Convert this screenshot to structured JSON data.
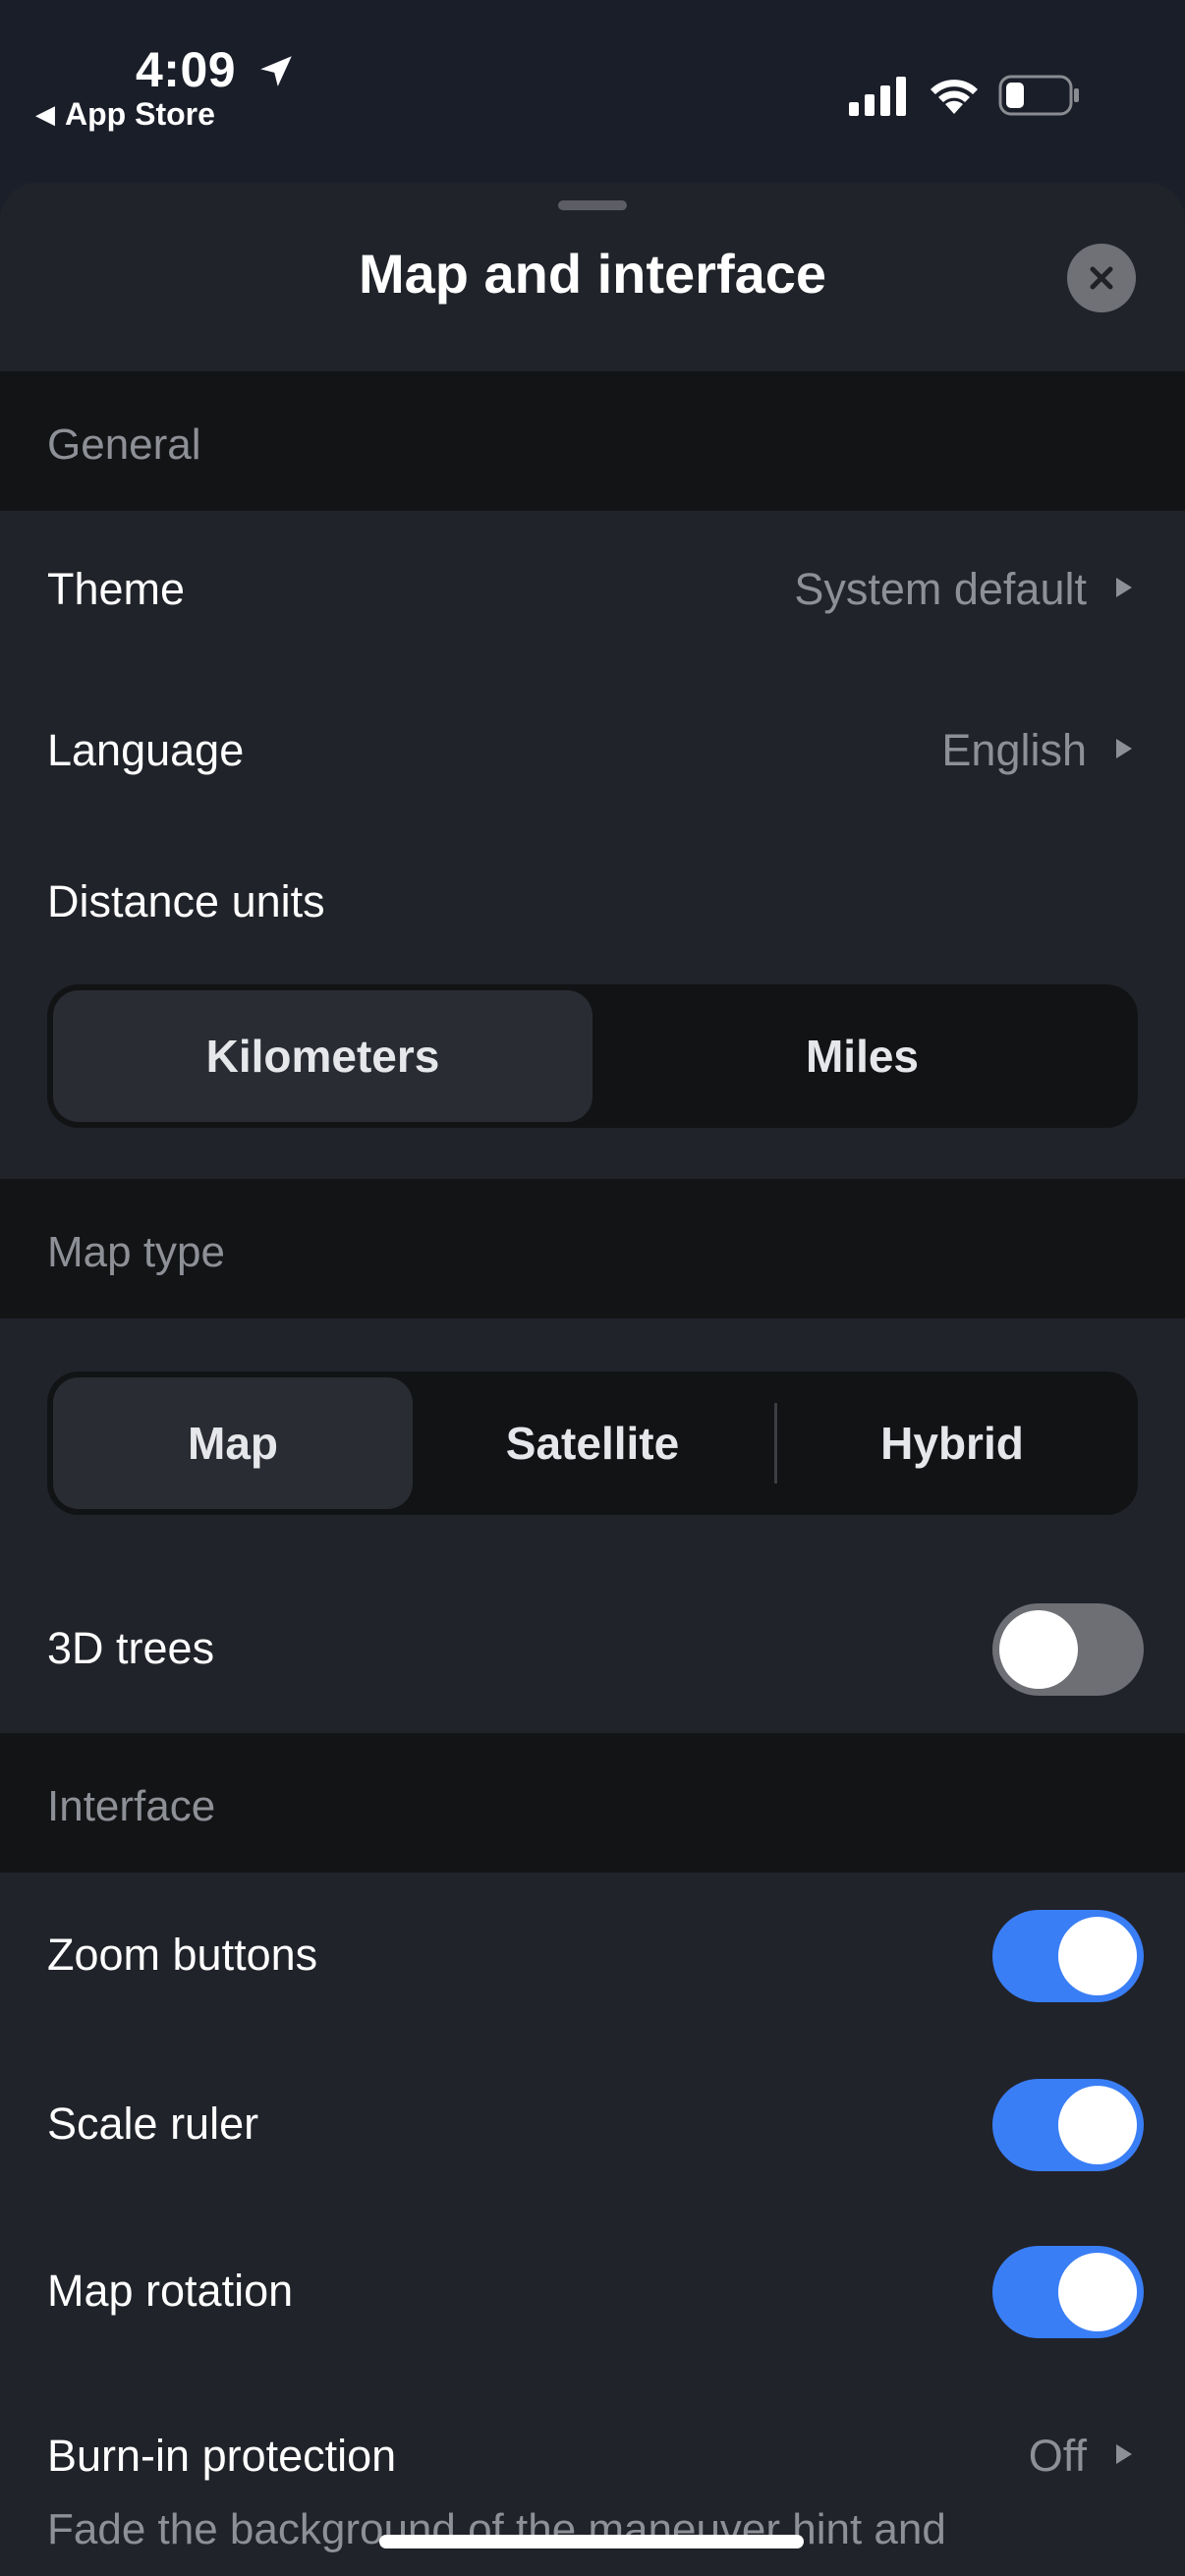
{
  "status_bar": {
    "time": "4:09",
    "back_app": "App Store",
    "icons": [
      "location-arrow-icon",
      "cellular-signal-icon",
      "wifi-icon",
      "battery-icon"
    ]
  },
  "sheet": {
    "title": "Map and interface",
    "close_icon": "close-icon"
  },
  "general": {
    "header": "General",
    "theme": {
      "label": "Theme",
      "value": "System default"
    },
    "language": {
      "label": "Language",
      "value": "English"
    },
    "distance_units": {
      "label": "Distance units",
      "options": [
        "Kilometers",
        "Miles"
      ],
      "selected": "Kilometers"
    }
  },
  "map_type": {
    "header": "Map type",
    "options": [
      "Map",
      "Satellite",
      "Hybrid"
    ],
    "selected": "Map",
    "trees_3d": {
      "label": "3D trees",
      "on": false
    }
  },
  "interface": {
    "header": "Interface",
    "zoom_buttons": {
      "label": "Zoom buttons",
      "on": true
    },
    "scale_ruler": {
      "label": "Scale ruler",
      "on": true
    },
    "map_rotation": {
      "label": "Map rotation",
      "on": true
    },
    "burn_in": {
      "label": "Burn-in protection",
      "value": "Off",
      "description": "Fade the background of the maneuver hint and"
    }
  },
  "colors": {
    "accent": "#3a7ef6",
    "sheet_bg": "#21232a",
    "section_bg": "#131416",
    "secondary_text": "#8e9097"
  }
}
